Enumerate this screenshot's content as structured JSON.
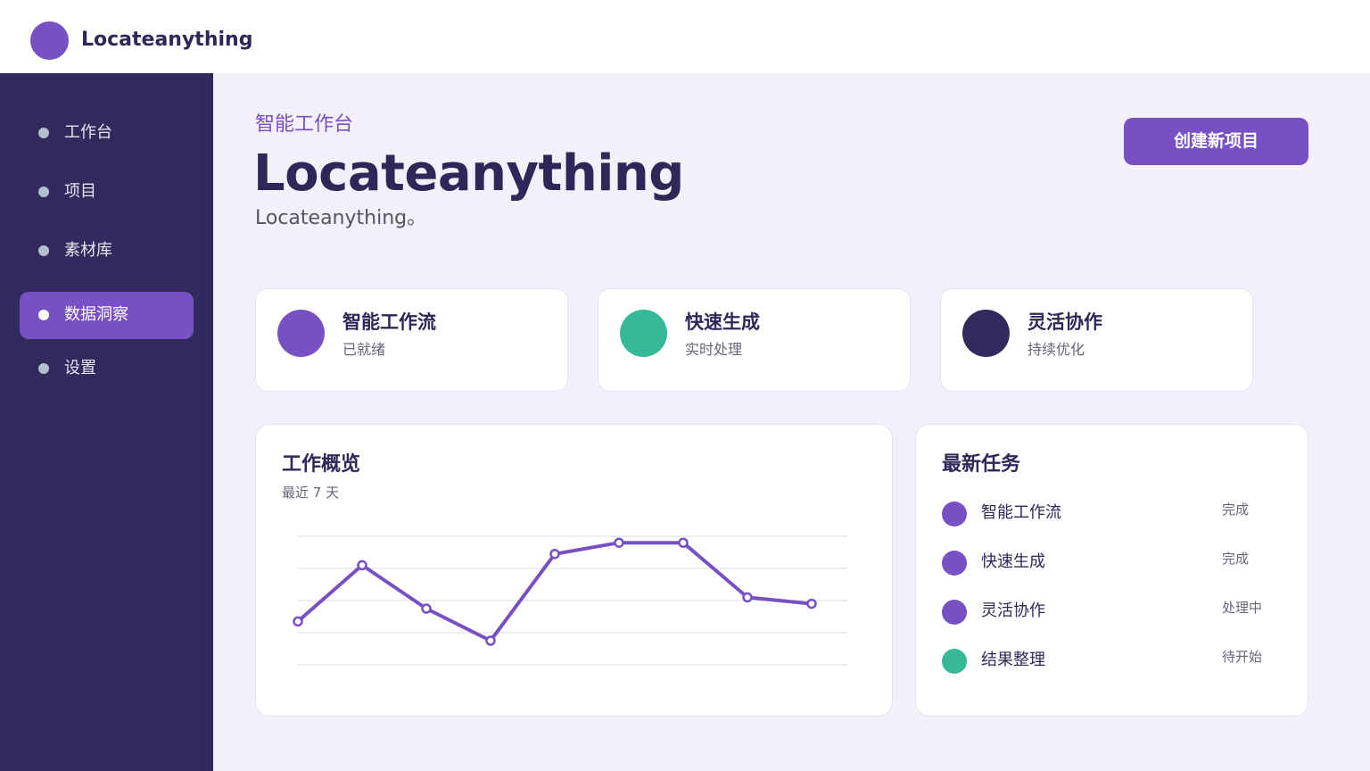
{
  "app": {
    "brand": "Locateanything"
  },
  "sidebar": {
    "items": [
      {
        "label": "工作台",
        "active": false
      },
      {
        "label": "项目",
        "active": false
      },
      {
        "label": "素材库",
        "active": false
      },
      {
        "label": "数据洞察",
        "active": true
      },
      {
        "label": "设置",
        "active": false
      }
    ]
  },
  "header": {
    "eyebrow": "智能工作台",
    "title": "Locateanything",
    "subtitle": "Locateanything。",
    "create_button": "创建新项目"
  },
  "stats": [
    {
      "title": "智能工作流",
      "sub": "已就绪",
      "color": "#7751c3"
    },
    {
      "title": "快速生成",
      "sub": "实时处理",
      "color": "#36b996"
    },
    {
      "title": "灵活协作",
      "sub": "持续优化",
      "color": "#322a5c"
    }
  ],
  "overview": {
    "title": "工作概览",
    "sub": "最近 7 天"
  },
  "chart_data": {
    "type": "line",
    "x": [
      1,
      2,
      3,
      4,
      5,
      6,
      7,
      8,
      9
    ],
    "series": [
      {
        "values": [
          27,
          62,
          35,
          15,
          69,
          76,
          76,
          42,
          38
        ]
      }
    ],
    "ylim": [
      0,
      80
    ],
    "grid": true,
    "color": "#7751c3"
  },
  "tasks": {
    "title": "最新任务",
    "items": [
      {
        "name": "智能工作流",
        "status": "完成",
        "color": "#7751c3"
      },
      {
        "name": "快速生成",
        "status": "完成",
        "color": "#7751c3"
      },
      {
        "name": "灵活协作",
        "status": "处理中",
        "color": "#7751c3"
      },
      {
        "name": "结果整理",
        "status": "待开始",
        "color": "#36b996"
      }
    ]
  }
}
